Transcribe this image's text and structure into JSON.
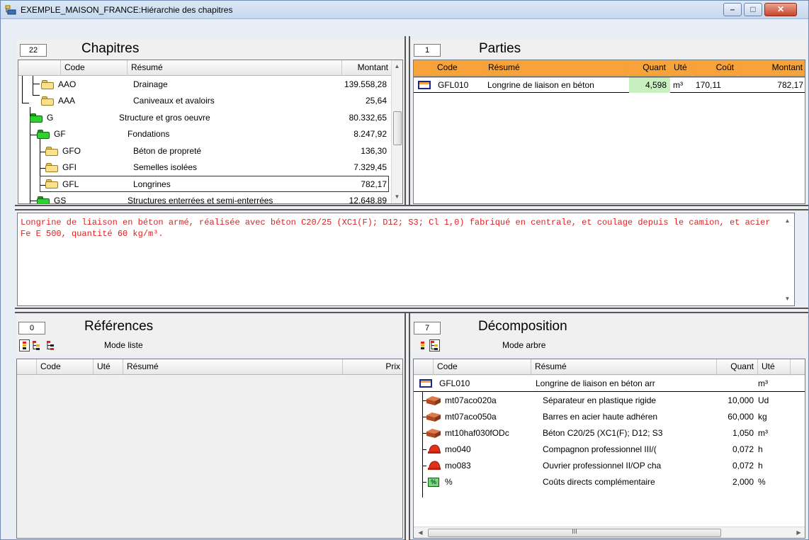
{
  "window": {
    "title": "EXEMPLE_MAISON_FRANCE:Hiérarchie des chapitres",
    "minimize_glyph": "–",
    "maximize_glyph": "□",
    "close_glyph": "✕"
  },
  "chapitres": {
    "count": "22",
    "title": "Chapitres",
    "columns": {
      "code": "Code",
      "resume": "Résumé",
      "montant": "Montant"
    },
    "rows": [
      {
        "code": "AAO",
        "resume": "Drainage",
        "montant": "139.558,28"
      },
      {
        "code": "AAA",
        "resume": "Caniveaux et avaloirs",
        "montant": "25,64"
      },
      {
        "code": "G",
        "resume": "Structure et gros oeuvre",
        "montant": "80.332,65"
      },
      {
        "code": "GF",
        "resume": "Fondations",
        "montant": "8.247,92"
      },
      {
        "code": "GFO",
        "resume": "Béton de propreté",
        "montant": "136,30"
      },
      {
        "code": "GFI",
        "resume": "Semelles isolées",
        "montant": "7.329,45"
      },
      {
        "code": "GFL",
        "resume": "Longrines",
        "montant": "782,17"
      },
      {
        "code": "GS",
        "resume": "Structures enterrées et semi-enterrées",
        "montant": "12.648,89"
      }
    ]
  },
  "parties": {
    "count": "1",
    "title": "Parties",
    "columns": {
      "code": "Code",
      "resume": "Résumé",
      "quant": "Quant",
      "ute": "Uté",
      "cout": "Coût",
      "montant": "Montant"
    },
    "rows": [
      {
        "code": "GFL010",
        "resume": "Longrine de liaison en béton",
        "quant": "4,598",
        "ute": "m³",
        "cout": "170,11",
        "montant": "782,17"
      }
    ]
  },
  "description": {
    "text": "Longrine de liaison en béton armé, réalisée avec béton C20/25 (XC1(F); D12; S3; Cl 1,0) fabriqué en centrale, et coulage depuis le camion, et acier Fe E 500, quantité 60 kg/m³."
  },
  "references": {
    "count": "0",
    "title": "Références",
    "mode": "Mode liste",
    "columns": {
      "code": "Code",
      "ute": "Uté",
      "resume": "Résumé",
      "prix": "Prix"
    }
  },
  "decomposition": {
    "count": "7",
    "title": "Décomposition",
    "mode": "Mode arbre",
    "columns": {
      "code": "Code",
      "resume": "Résumé",
      "quant": "Quant",
      "ute": "Uté"
    },
    "rows": [
      {
        "code": "GFL010",
        "resume": "Longrine de liaison en béton arr",
        "quant": "",
        "ute": "m³",
        "icon": "unit-icon"
      },
      {
        "code": "mt07aco020a",
        "resume": "Séparateur en plastique rigide",
        "quant": "10,000",
        "ute": "Ud",
        "icon": "brick-icon"
      },
      {
        "code": "mt07aco050a",
        "resume": "Barres en acier haute adhéren",
        "quant": "60,000",
        "ute": "kg",
        "icon": "brick-icon"
      },
      {
        "code": "mt10haf030fODc",
        "resume": "Béton C20/25 (XC1(F); D12; S3",
        "quant": "1,050",
        "ute": "m³",
        "icon": "brick-icon"
      },
      {
        "code": "mo040",
        "resume": "Compagnon professionnel III/(",
        "quant": "0,072",
        "ute": "h",
        "icon": "helmet-icon"
      },
      {
        "code": "mo083",
        "resume": "Ouvrier professionnel II/OP cha",
        "quant": "0,072",
        "ute": "h",
        "icon": "helmet-icon"
      },
      {
        "code": "%",
        "resume": "Coûts directs complémentaire",
        "quant": "2,000",
        "ute": "%",
        "icon": "percent-icon",
        "icon_text": "%"
      }
    ],
    "scroll_grip": "III"
  },
  "colors": {
    "accent_orange": "#f7a33a",
    "description_text": "#e02020",
    "highlight_green": "#c8f0c0"
  }
}
